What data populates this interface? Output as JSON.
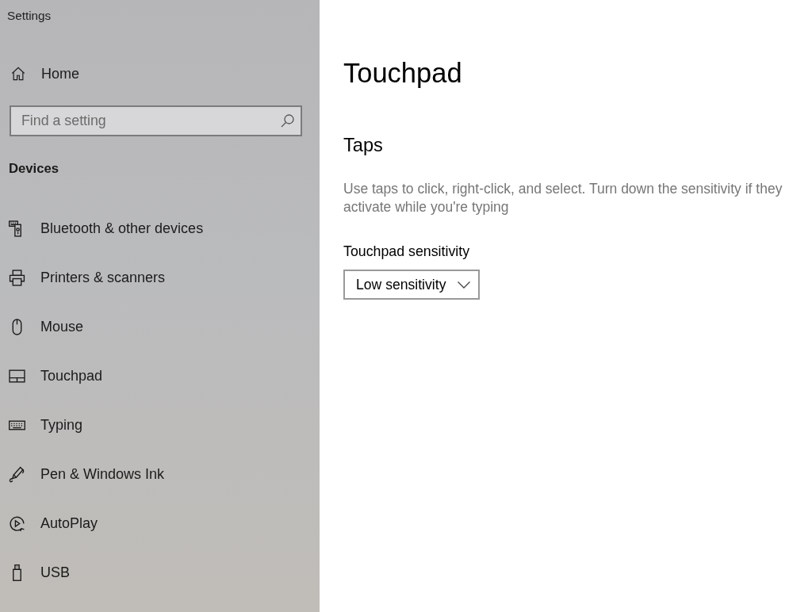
{
  "window": {
    "title": "Settings"
  },
  "sidebar": {
    "home": {
      "label": "Home"
    },
    "search": {
      "placeholder": "Find a setting"
    },
    "section_title": "Devices",
    "items": [
      {
        "label": "Bluetooth & other devices"
      },
      {
        "label": "Printers & scanners"
      },
      {
        "label": "Mouse"
      },
      {
        "label": "Touchpad"
      },
      {
        "label": "Typing"
      },
      {
        "label": "Pen & Windows Ink"
      },
      {
        "label": "AutoPlay"
      },
      {
        "label": "USB"
      }
    ]
  },
  "page": {
    "title": "Touchpad",
    "sections": [
      {
        "heading": "Taps",
        "description": "Use taps to click, right-click, and select. Turn down the sensitivity if they activate while you're typing",
        "dropdown": {
          "label": "Touchpad sensitivity",
          "value": "Low sensitivity"
        }
      }
    ]
  }
}
